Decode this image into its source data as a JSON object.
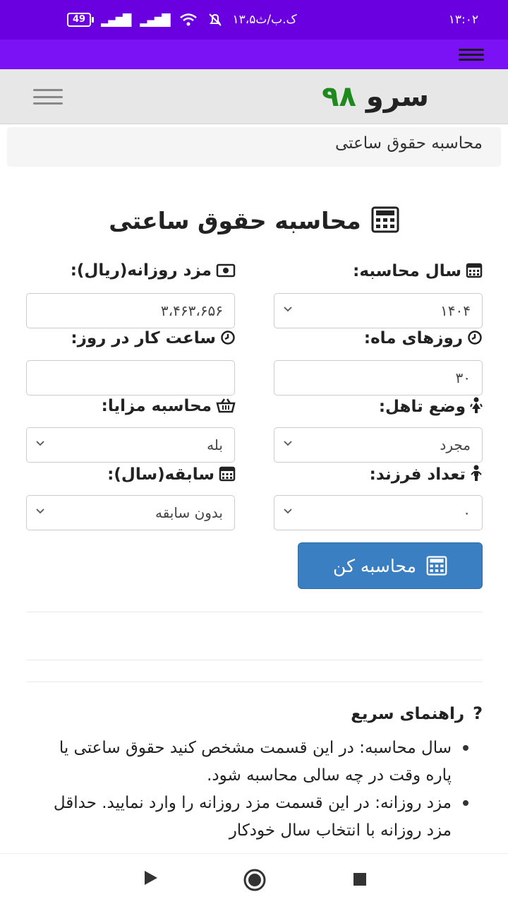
{
  "status_bar": {
    "time": "۱۳:۰۲",
    "notif_text": "۱۳،۵ک.ب/ث",
    "battery": "49"
  },
  "navbar": {
    "brand_text": "سرو",
    "brand_number": "۹۸"
  },
  "breadcrumb": "محاسبه حقوق ساعتی",
  "page_title": "محاسبه حقوق ساعتی",
  "form": {
    "year_label": "سال محاسبه:",
    "year_value": "۱۴۰۴",
    "daily_wage_label": "مزد روزانه(ریال):",
    "daily_wage_value": "۳،۴۶۳،۶۵۶",
    "month_days_label": "روزهای ماه:",
    "month_days_value": "۳۰",
    "work_hours_label": "ساعت کار در روز:",
    "work_hours_value": "",
    "marital_label": "وضع تاهل:",
    "marital_value": "مجرد",
    "benefits_label": "محاسبه مزایا:",
    "benefits_value": "بله",
    "children_label": "تعداد فرزند:",
    "children_value": "۰",
    "experience_label": "سابقه(سال):",
    "experience_value": "بدون سابقه",
    "submit_label": "محاسبه کن"
  },
  "help": {
    "title": "راهنمای سریع",
    "items": [
      "سال محاسبه: در این قسمت مشخص کنید حقوق ساعتی یا پاره وقت در چه سالی محاسبه شود.",
      "مزد روزانه: در این قسمت مزد روزانه را وارد نمایید. حداقل مزد روزانه با انتخاب سال خودکار"
    ]
  },
  "colors": {
    "status_bar": "#6a00e0",
    "app_bar": "#7b12f5",
    "primary_button": "#3a7fc1",
    "brand_number": "#1e8a1e"
  }
}
